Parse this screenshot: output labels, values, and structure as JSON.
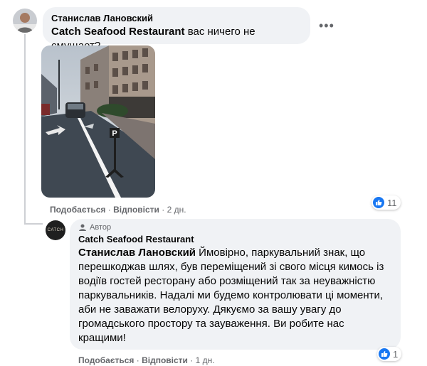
{
  "comment1": {
    "author": "Станислав Лановский",
    "mention": "Catch Seafood Restaurant",
    "text": " вас ничего не смущает?",
    "more": "•••",
    "actions": {
      "like": "Подобається",
      "reply": "Відповісти",
      "time": "2 дн."
    },
    "reaction_count": "11",
    "photo_icon": "parking-sign-street-photo"
  },
  "comment2": {
    "badge": "Автор",
    "author": "Catch Seafood Restaurant",
    "avatar_text": "CATCH",
    "mention": "Станислав Лановский",
    "text": " Ймовірно, паркувальний знак, що перешкоджав шлях, був переміщений зі свого місця кимось із водіїв гостей ресторану або розміщений так за неуважністю паркувальників. Надалі ми будемо контролювати ці моменти, аби не заважати велоруху. Дякуємо за вашу увагу до громадського простору та зауваження. Ви робите нас кращими!",
    "actions": {
      "like": "Подобається",
      "reply": "Відповісти",
      "time": "1 дн."
    },
    "reaction_count": "1"
  },
  "colors": {
    "like_blue": "#1877f2",
    "bubble": "#f0f2f5",
    "meta": "#65676b"
  }
}
